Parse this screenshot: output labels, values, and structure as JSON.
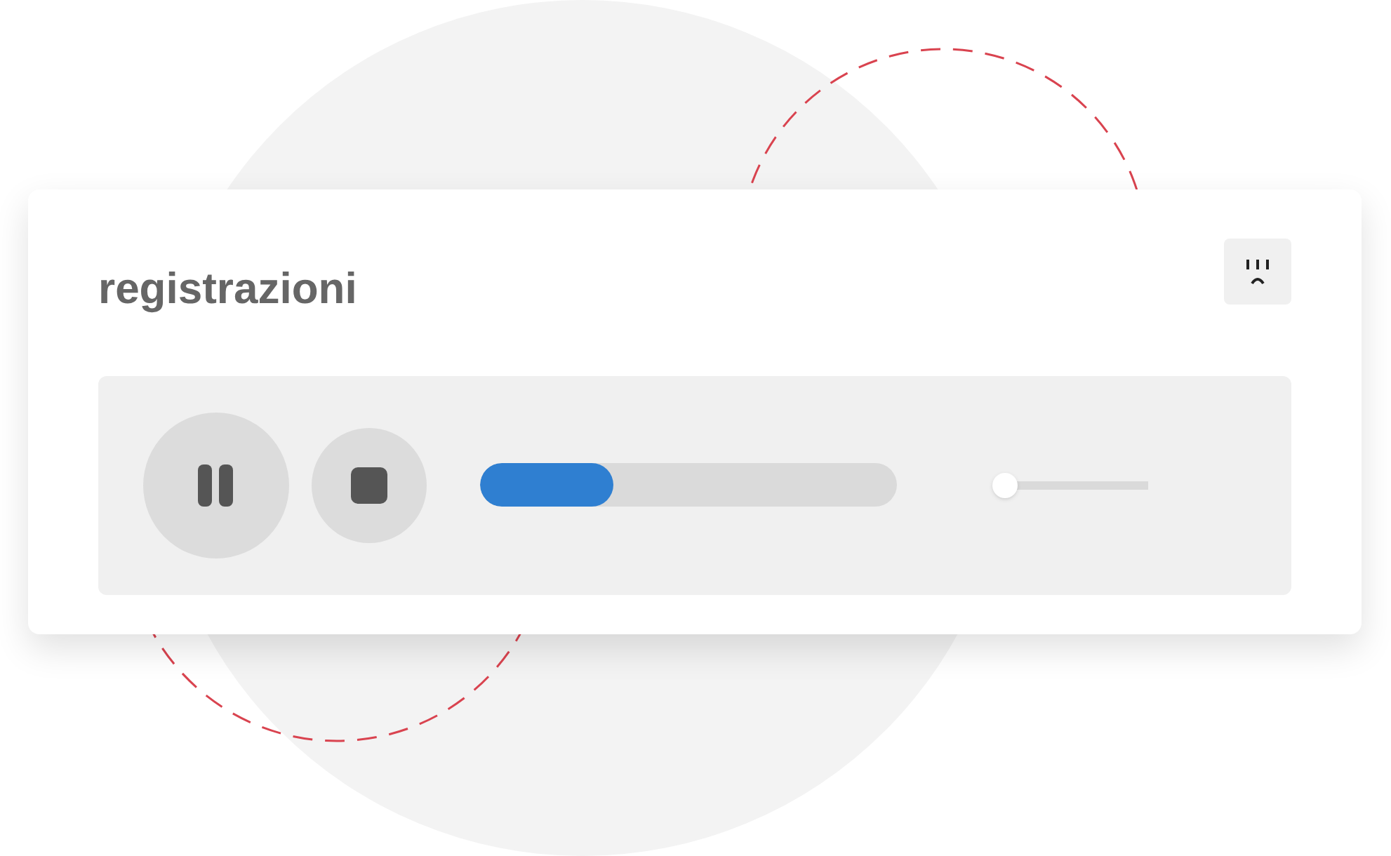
{
  "title": "registrazioni",
  "player": {
    "playing": true,
    "progress": {
      "level": 0.32
    },
    "volume": {
      "level": 0.04
    }
  }
}
